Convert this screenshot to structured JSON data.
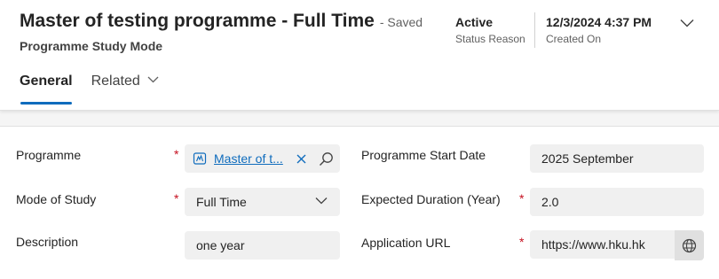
{
  "header": {
    "title": "Master of testing programme - Full Time",
    "saved_status": "- Saved",
    "entity_name": "Programme Study Mode",
    "status_reason": {
      "value": "Active",
      "label": "Status Reason"
    },
    "created_on": {
      "value": "12/3/2024 4:37 PM",
      "label": "Created On"
    }
  },
  "tabs": [
    {
      "label": "General",
      "active": true
    },
    {
      "label": "Related",
      "active": false
    }
  ],
  "form": {
    "programme": {
      "label": "Programme",
      "required": "*",
      "value": "Master of testing programme",
      "display": "Master of t..."
    },
    "mode_of_study": {
      "label": "Mode of Study",
      "required": "*",
      "value": "Full Time"
    },
    "description": {
      "label": "Description",
      "value": "one year"
    },
    "programme_start_date": {
      "label": "Programme Start Date",
      "value": "2025 September"
    },
    "expected_duration": {
      "label": "Expected Duration (Year)",
      "required": "*",
      "value": "2.0"
    },
    "application_url": {
      "label": "Application URL",
      "required": "*",
      "value": "https://www.hku.hk"
    }
  },
  "colors": {
    "accent": "#0f6cbd",
    "required": "#c50f1f",
    "field_bg": "#f0f0f0"
  },
  "icons": [
    "chevron-down-icon",
    "entity-icon",
    "close-icon",
    "search-icon",
    "globe-icon"
  ]
}
